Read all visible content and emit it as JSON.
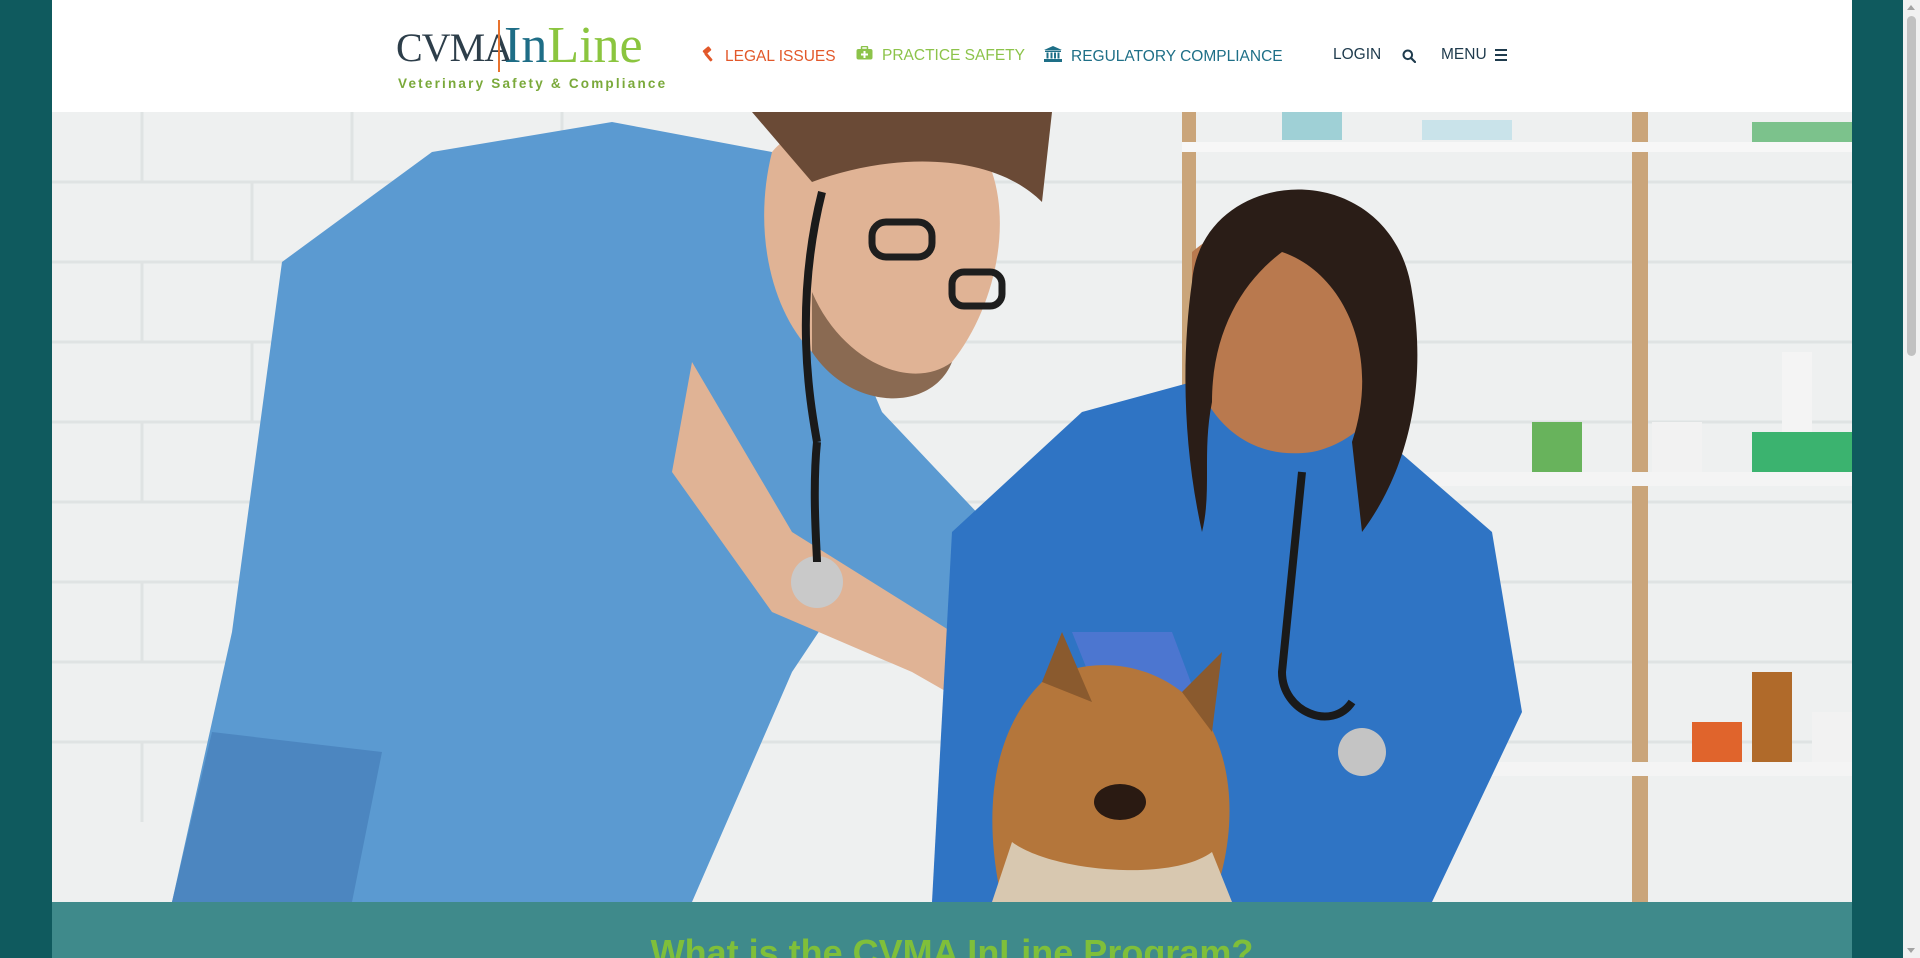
{
  "logo": {
    "mark": "CVMA",
    "in": "In",
    "line": "Line",
    "tagline": "Veterinary Safety & Compliance"
  },
  "nav": {
    "legal_issues": "LEGAL ISSUES",
    "practice_safety": "PRACTICE SAFETY",
    "regulatory_compliance": "REGULATORY COMPLIANCE",
    "login": "LOGIN",
    "menu": "MENU"
  },
  "icons": {
    "legal": "gavel-icon",
    "safety": "first-aid-kit-icon",
    "regulatory": "institution-icon",
    "search": "search-icon",
    "menu": "hamburger-icon"
  },
  "hero": {
    "banner_title": "What is the CVMA InLine Program?"
  },
  "colors": {
    "frame": "#0f5a5e",
    "legal": "#e2582a",
    "safety": "#8cc34a",
    "regulatory": "#1e6f87",
    "banner": "#3f8a8b",
    "banner_text": "#7fbf3a"
  }
}
